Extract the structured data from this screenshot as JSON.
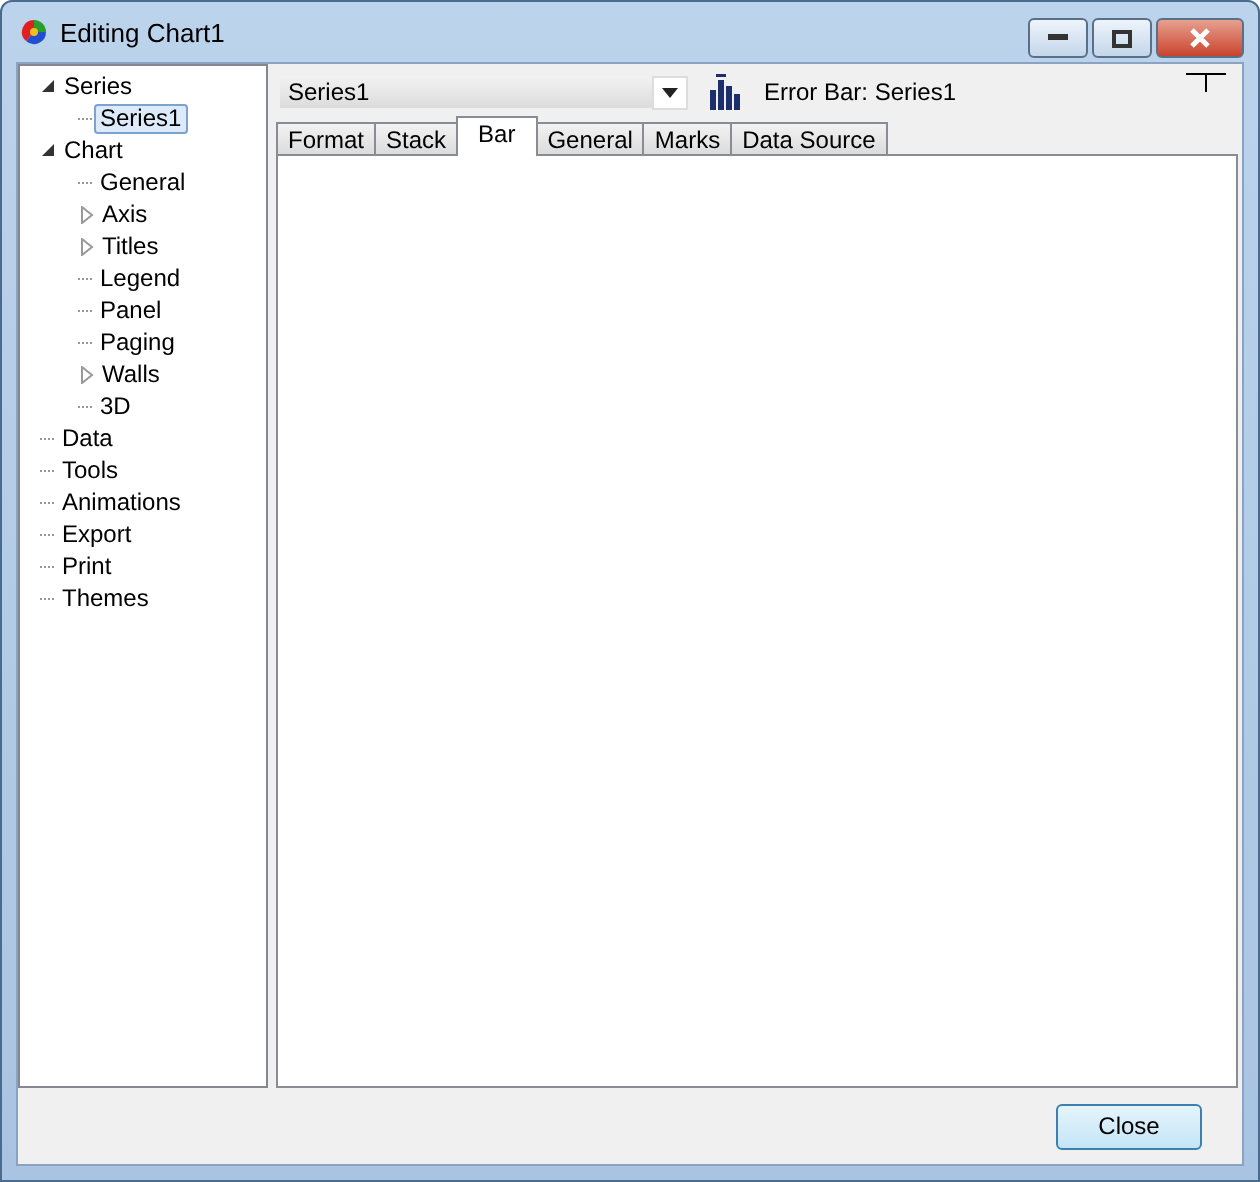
{
  "window": {
    "title": "Editing Chart1"
  },
  "tree": [
    {
      "label": "Series",
      "expanded": true,
      "selected": false,
      "children": [
        {
          "label": "Series1",
          "selected": true
        }
      ]
    },
    {
      "label": "Chart",
      "expanded": true,
      "selected": false,
      "children": [
        {
          "label": "General",
          "selected": false
        },
        {
          "label": "Axis",
          "expanded": false,
          "selected": false
        },
        {
          "label": "Titles",
          "expanded": false,
          "selected": false
        },
        {
          "label": "Legend",
          "selected": false
        },
        {
          "label": "Panel",
          "selected": false
        },
        {
          "label": "Paging",
          "selected": false
        },
        {
          "label": "Walls",
          "expanded": false,
          "selected": false
        },
        {
          "label": "3D",
          "selected": false
        }
      ]
    },
    {
      "label": "Data",
      "selected": false
    },
    {
      "label": "Tools",
      "selected": false
    },
    {
      "label": "Animations",
      "selected": false
    },
    {
      "label": "Export",
      "selected": false
    },
    {
      "label": "Print",
      "selected": false
    },
    {
      "label": "Themes",
      "selected": false
    }
  ],
  "series_select": {
    "value": "Series1"
  },
  "series_caption": "Error Bar: Series1",
  "tabs": [
    {
      "label": "Format",
      "selected": false
    },
    {
      "label": "Stack",
      "selected": false
    },
    {
      "label": "Bar",
      "selected": true
    },
    {
      "label": "General",
      "selected": false
    },
    {
      "label": "Marks",
      "selected": false
    },
    {
      "label": "Data Source",
      "selected": false
    }
  ],
  "buttons": [
    "Close"
  ]
}
